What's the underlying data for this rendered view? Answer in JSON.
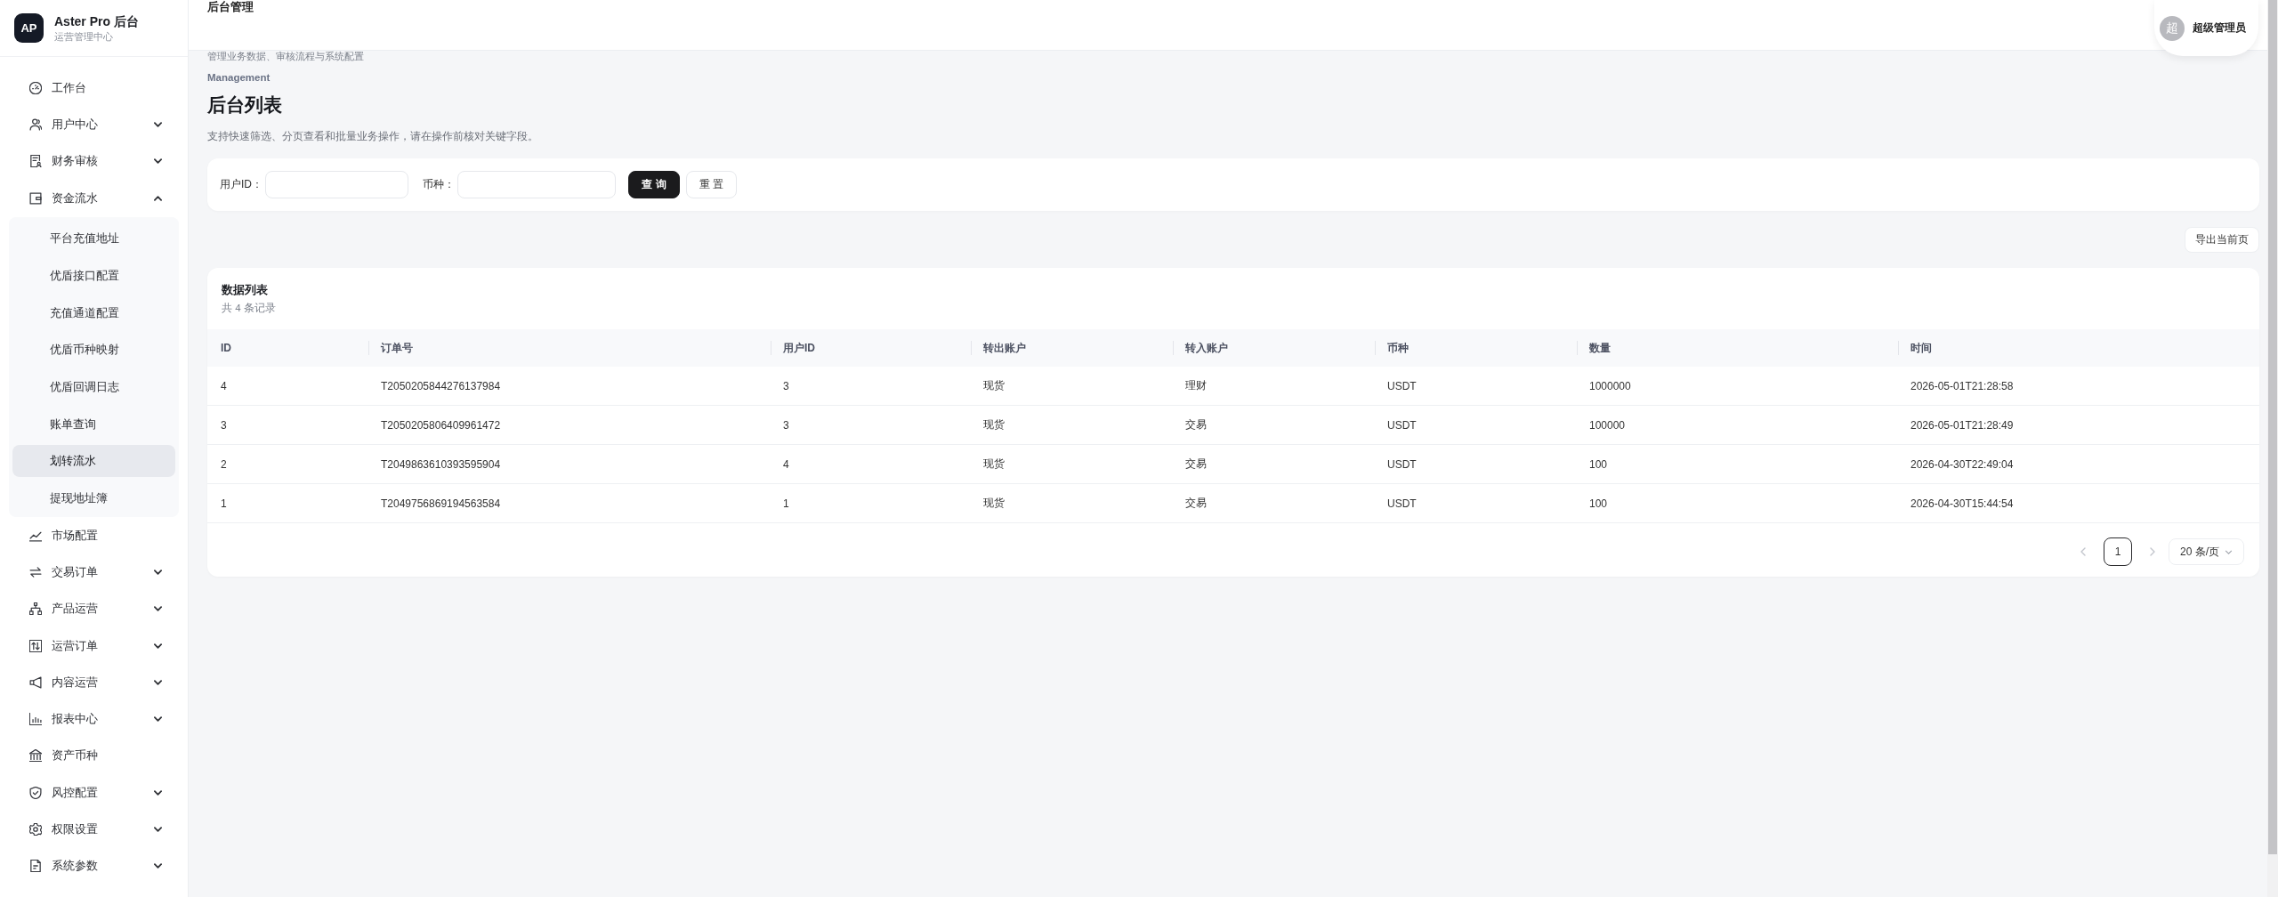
{
  "header": {
    "title": "后台管理",
    "user": {
      "avatar": "超",
      "name": "超级管理员"
    }
  },
  "sidebar": {
    "logo": "AP",
    "title": "Aster Pro 后台",
    "subtitle": "运营管理中心",
    "menu": [
      {
        "kind": "link",
        "label": "工作台",
        "selected": false
      },
      {
        "kind": "group",
        "label": "用户中心",
        "selected": false,
        "expanded": false
      },
      {
        "kind": "group",
        "label": "财务审核",
        "selected": false,
        "expanded": false
      },
      {
        "kind": "group",
        "label": "资金流水",
        "selected": false,
        "expanded": true,
        "children": [
          {
            "label": "平台充值地址",
            "selected": false
          },
          {
            "label": "优盾接口配置",
            "selected": false
          },
          {
            "label": "充值通道配置",
            "selected": false
          },
          {
            "label": "优盾币种映射",
            "selected": false
          },
          {
            "label": "优盾回调日志",
            "selected": false
          },
          {
            "label": "账单查询",
            "selected": false
          },
          {
            "label": "划转流水",
            "selected": true
          },
          {
            "label": "提现地址簿",
            "selected": false
          }
        ]
      },
      {
        "kind": "link",
        "label": "市场配置",
        "selected": false
      },
      {
        "kind": "group",
        "label": "交易订单",
        "selected": false,
        "expanded": false
      },
      {
        "kind": "group",
        "label": "产品运营",
        "selected": false,
        "expanded": false
      },
      {
        "kind": "group",
        "label": "运营订单",
        "selected": false,
        "expanded": false
      },
      {
        "kind": "group",
        "label": "内容运营",
        "selected": false,
        "expanded": false
      },
      {
        "kind": "group",
        "label": "报表中心",
        "selected": false,
        "expanded": false
      },
      {
        "kind": "link",
        "label": "资产币种",
        "selected": false
      },
      {
        "kind": "group",
        "label": "风控配置",
        "selected": false,
        "expanded": false
      },
      {
        "kind": "group",
        "label": "权限设置",
        "selected": false,
        "expanded": false
      },
      {
        "kind": "group",
        "label": "系统参数",
        "selected": false,
        "expanded": false
      }
    ]
  },
  "page": {
    "subtitle": "管理业务数据、审核流程与系统配置",
    "eyebrow": "Management",
    "title": "后台列表",
    "description": "支持快速筛选、分页查看和批量业务操作，请在操作前核对关键字段。"
  },
  "filters": {
    "fields": [
      {
        "label": "用户ID："
      },
      {
        "label": "币种："
      }
    ],
    "buttons": [
      {
        "kind": "primary",
        "label": "查 询"
      },
      {
        "kind": "default",
        "label": "重 置"
      }
    ]
  },
  "toolbar": {
    "export_button": "导出当前页"
  },
  "table": {
    "title": "数据列表",
    "count": "共 4 条记录",
    "columns": [
      "ID",
      "订单号",
      "用户ID",
      "转出账户",
      "转入账户",
      "币种",
      "数量",
      "时间"
    ],
    "rows": [
      [
        "4",
        "T2050205844276137984",
        "3",
        "现货",
        "理财",
        "USDT",
        "1000000",
        "2026-05-01T21:28:58"
      ],
      [
        "3",
        "T2050205806409961472",
        "3",
        "现货",
        "交易",
        "USDT",
        "100000",
        "2026-05-01T21:28:49"
      ],
      [
        "2",
        "T2049863610393595904",
        "4",
        "现货",
        "交易",
        "USDT",
        "100",
        "2026-04-30T22:49:04"
      ],
      [
        "1",
        "T2049756869194563584",
        "1",
        "现货",
        "交易",
        "USDT",
        "100",
        "2026-04-30T15:44:54"
      ]
    ]
  },
  "pagination": {
    "prev": {
      "disabled": true
    },
    "pages": [
      {
        "label": "1",
        "selected": true
      }
    ],
    "next": {
      "disabled": true
    },
    "page_size": "20 条/页"
  }
}
